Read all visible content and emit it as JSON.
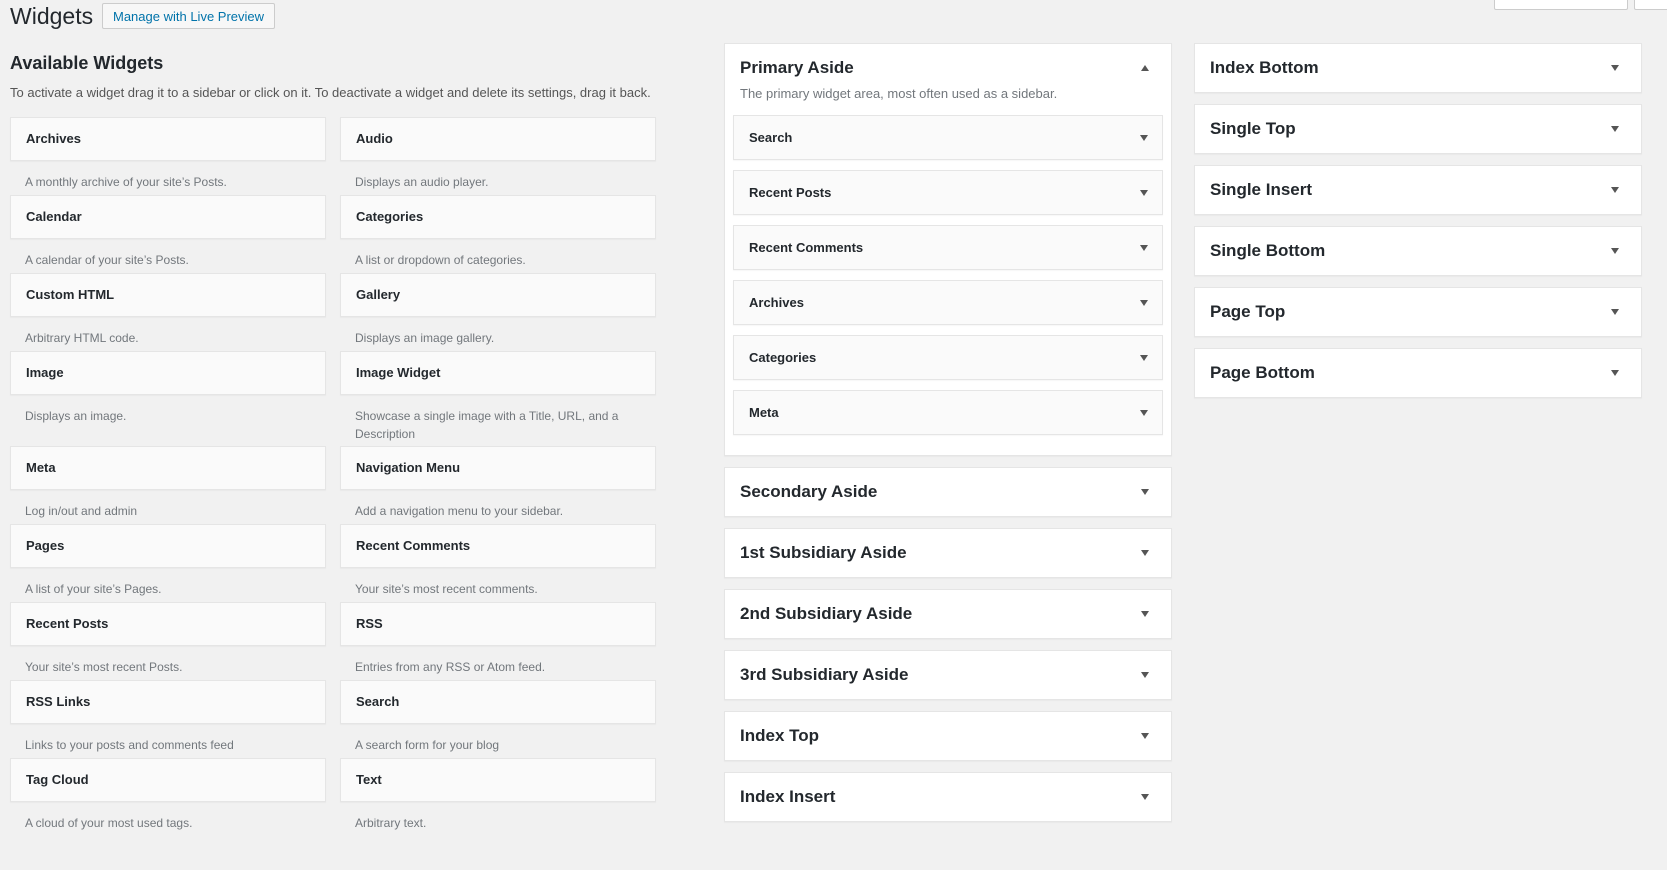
{
  "header": {
    "title": "Widgets",
    "live_preview_label": "Manage with Live Preview"
  },
  "available": {
    "title": "Available Widgets",
    "description": "To activate a widget drag it to a sidebar or click on it. To deactivate a widget and delete its settings, drag it back.",
    "widgets": [
      {
        "title": "Archives",
        "desc": "A monthly archive of your site’s Posts."
      },
      {
        "title": "Audio",
        "desc": "Displays an audio player."
      },
      {
        "title": "Calendar",
        "desc": "A calendar of your site’s Posts."
      },
      {
        "title": "Categories",
        "desc": "A list or dropdown of categories."
      },
      {
        "title": "Custom HTML",
        "desc": "Arbitrary HTML code."
      },
      {
        "title": "Gallery",
        "desc": "Displays an image gallery."
      },
      {
        "title": "Image",
        "desc": "Displays an image."
      },
      {
        "title": "Image Widget",
        "desc": "Showcase a single image with a Title, URL, and a Description"
      },
      {
        "title": "Meta",
        "desc": "Log in/out and admin"
      },
      {
        "title": "Navigation Menu",
        "desc": "Add a navigation menu to your sidebar."
      },
      {
        "title": "Pages",
        "desc": "A list of your site’s Pages."
      },
      {
        "title": "Recent Comments",
        "desc": "Your site’s most recent comments."
      },
      {
        "title": "Recent Posts",
        "desc": "Your site’s most recent Posts."
      },
      {
        "title": "RSS",
        "desc": "Entries from any RSS or Atom feed."
      },
      {
        "title": "RSS Links",
        "desc": "Links to your posts and comments feed"
      },
      {
        "title": "Search",
        "desc": "A search form for your blog"
      },
      {
        "title": "Tag Cloud",
        "desc": "A cloud of your most used tags."
      },
      {
        "title": "Text",
        "desc": "Arbitrary text."
      }
    ]
  },
  "primary_aside": {
    "title": "Primary Aside",
    "description": "The primary widget area, most often used as a sidebar.",
    "widgets": [
      "Search",
      "Recent Posts",
      "Recent Comments",
      "Archives",
      "Categories",
      "Meta"
    ]
  },
  "sidebars_col1": [
    "Secondary Aside",
    "1st Subsidiary Aside",
    "2nd Subsidiary Aside",
    "3rd Subsidiary Aside",
    "Index Top",
    "Index Insert"
  ],
  "sidebars_col2": [
    "Index Bottom",
    "Single Top",
    "Single Insert",
    "Single Bottom",
    "Page Top",
    "Page Bottom"
  ]
}
